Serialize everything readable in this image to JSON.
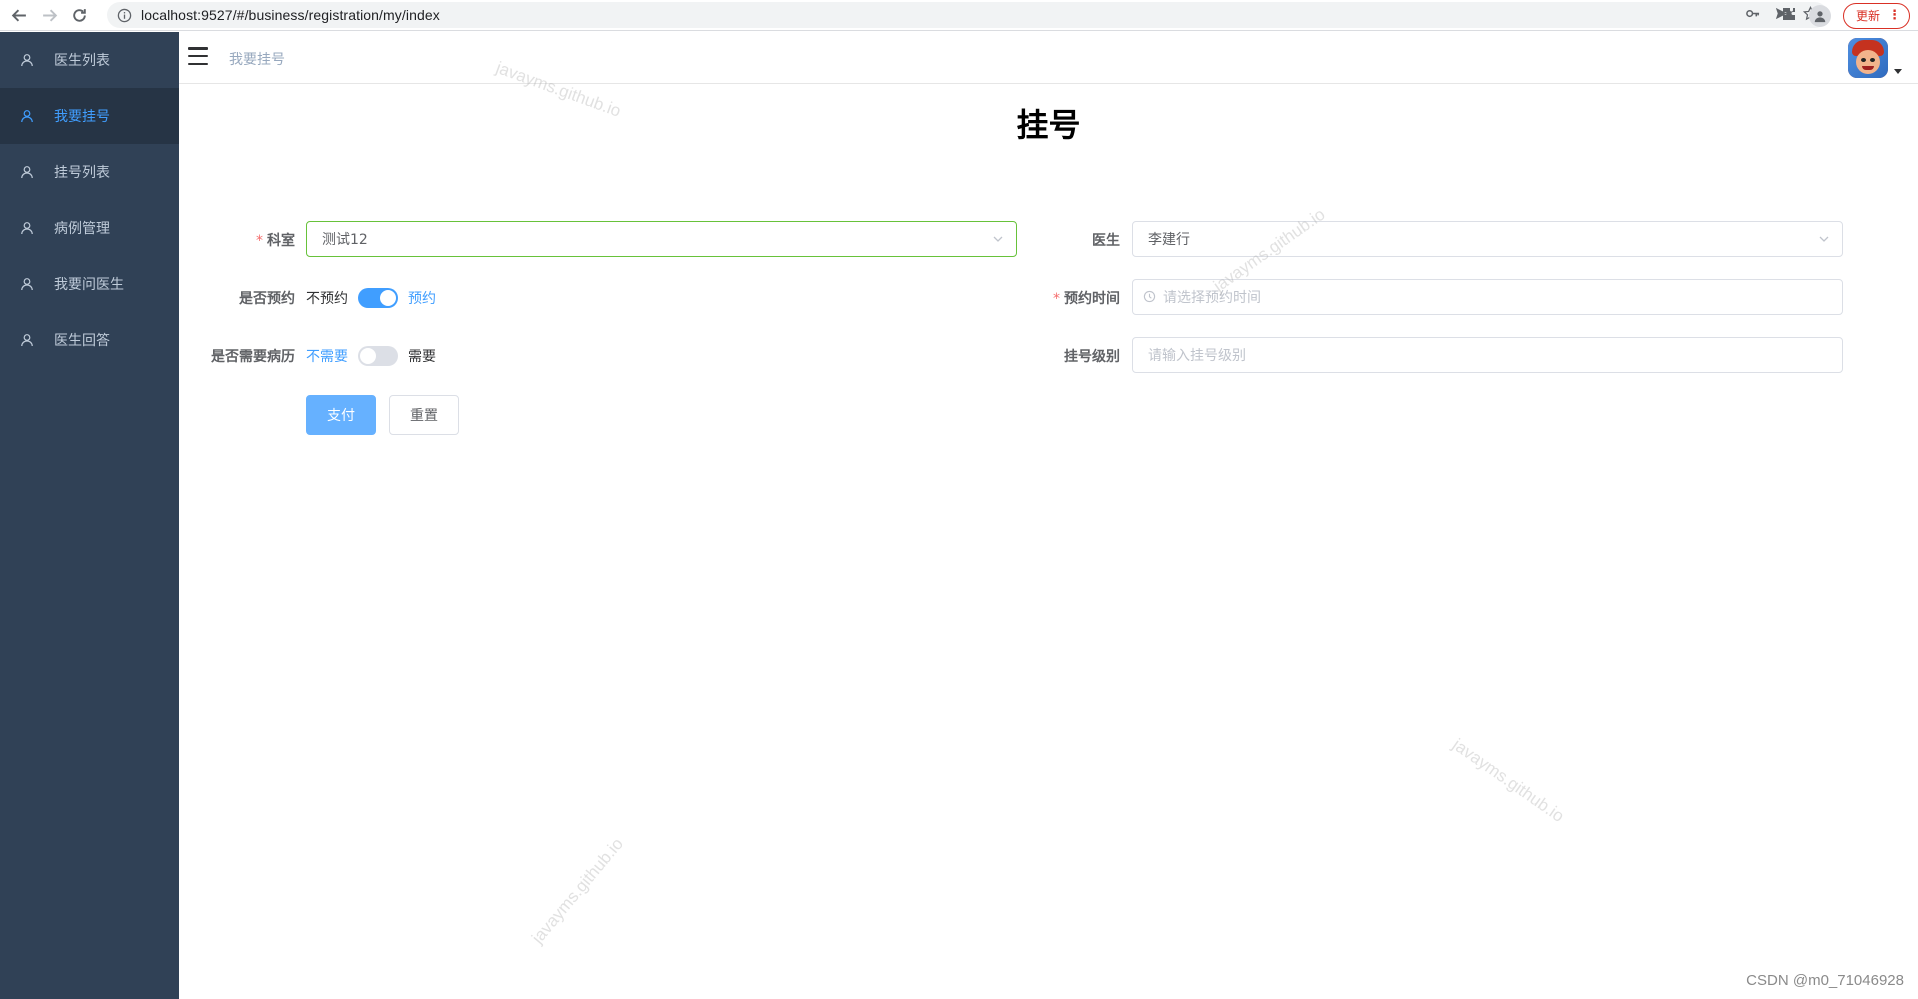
{
  "browser": {
    "url": "localhost:9527/#/business/registration/my/index",
    "update_label": "更新"
  },
  "sidebar": {
    "items": [
      {
        "label": "医生列表",
        "active": false
      },
      {
        "label": "我要挂号",
        "active": true
      },
      {
        "label": "挂号列表",
        "active": false
      },
      {
        "label": "病例管理",
        "active": false
      },
      {
        "label": "我要问医生",
        "active": false
      },
      {
        "label": "医生回答",
        "active": false
      }
    ]
  },
  "navbar": {
    "breadcrumb": "我要挂号"
  },
  "page": {
    "title": "挂号"
  },
  "form": {
    "department": {
      "label": "科室",
      "required": true,
      "value": "测试12"
    },
    "doctor": {
      "label": "医生",
      "required": false,
      "value": "李建行"
    },
    "appointment": {
      "label": "是否预约",
      "off_label": "不预约",
      "on_label": "预约",
      "value": true
    },
    "appointment_time": {
      "label": "预约时间",
      "required": true,
      "placeholder": "请选择预约时间"
    },
    "need_record": {
      "label": "是否需要病历",
      "off_label": "不需要",
      "on_label": "需要",
      "value": false
    },
    "level": {
      "label": "挂号级别",
      "placeholder": "请输入挂号级别"
    },
    "pay_label": "支付",
    "reset_label": "重置"
  },
  "watermark": "javayms.github.io",
  "footer": {
    "credit": "CSDN @m0_71046928"
  },
  "colors": {
    "sidebar_bg": "#304156",
    "active_menu": "#409eff",
    "primary_button": "#66b1ff",
    "success_border": "#67c23a",
    "required_asterisk": "#f56c6c"
  }
}
